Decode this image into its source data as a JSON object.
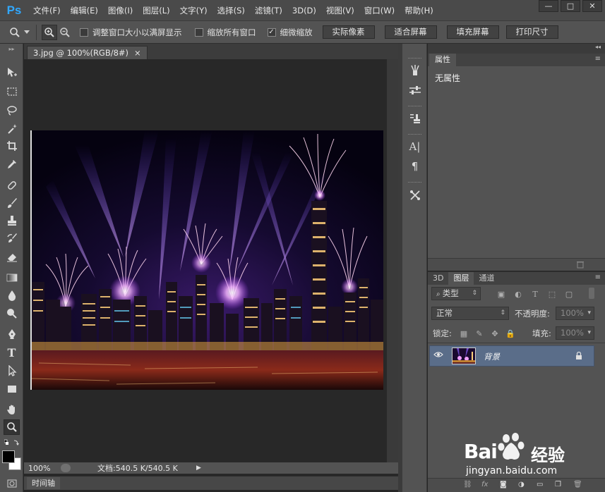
{
  "app": {
    "logo": "Ps"
  },
  "menu": [
    "文件(F)",
    "编辑(E)",
    "图像(I)",
    "图层(L)",
    "文字(Y)",
    "选择(S)",
    "滤镜(T)",
    "3D(D)",
    "视图(V)",
    "窗口(W)",
    "帮助(H)"
  ],
  "window_controls": {
    "minimize": "—",
    "restore": "□",
    "close": "✕"
  },
  "options": {
    "resize_windows": {
      "label": "调整窗口大小以满屏显示",
      "checked": false
    },
    "zoom_all": {
      "label": "缩放所有窗口",
      "checked": false
    },
    "scrubby_zoom": {
      "label": "细微缩放",
      "checked": true
    },
    "btn_actual_pixels": "实际像素",
    "btn_fit_screen": "适合屏幕",
    "btn_fill_screen": "填充屏幕",
    "btn_print_size": "打印尺寸"
  },
  "document": {
    "tab_title": "3.jpg @ 100%(RGB/8#)",
    "close": "×"
  },
  "status": {
    "zoom": "100%",
    "doc_info": "文档:540.5 K/540.5 K"
  },
  "timeline": {
    "tab": "时间轴"
  },
  "properties": {
    "tab": "属性",
    "empty_text": "无属性"
  },
  "layers": {
    "tabs": [
      "3D",
      "图层",
      "通道"
    ],
    "filter_kind": "类型",
    "blend_mode": "正常",
    "opacity_label": "不透明度:",
    "opacity_value": "100%",
    "lock_label": "锁定:",
    "fill_label": "填充:",
    "fill_value": "100%",
    "rows": [
      {
        "name": "背景",
        "visible": true,
        "locked": true
      }
    ]
  },
  "watermark": {
    "brand": "Bai",
    "brand_cn": "经验",
    "url": "jingyan.baidu.com"
  },
  "colors": {
    "accent": "#31a8ff",
    "selected_layer": "#5a6d89",
    "chrome": "#535353",
    "canvas_bg": "#282828"
  }
}
